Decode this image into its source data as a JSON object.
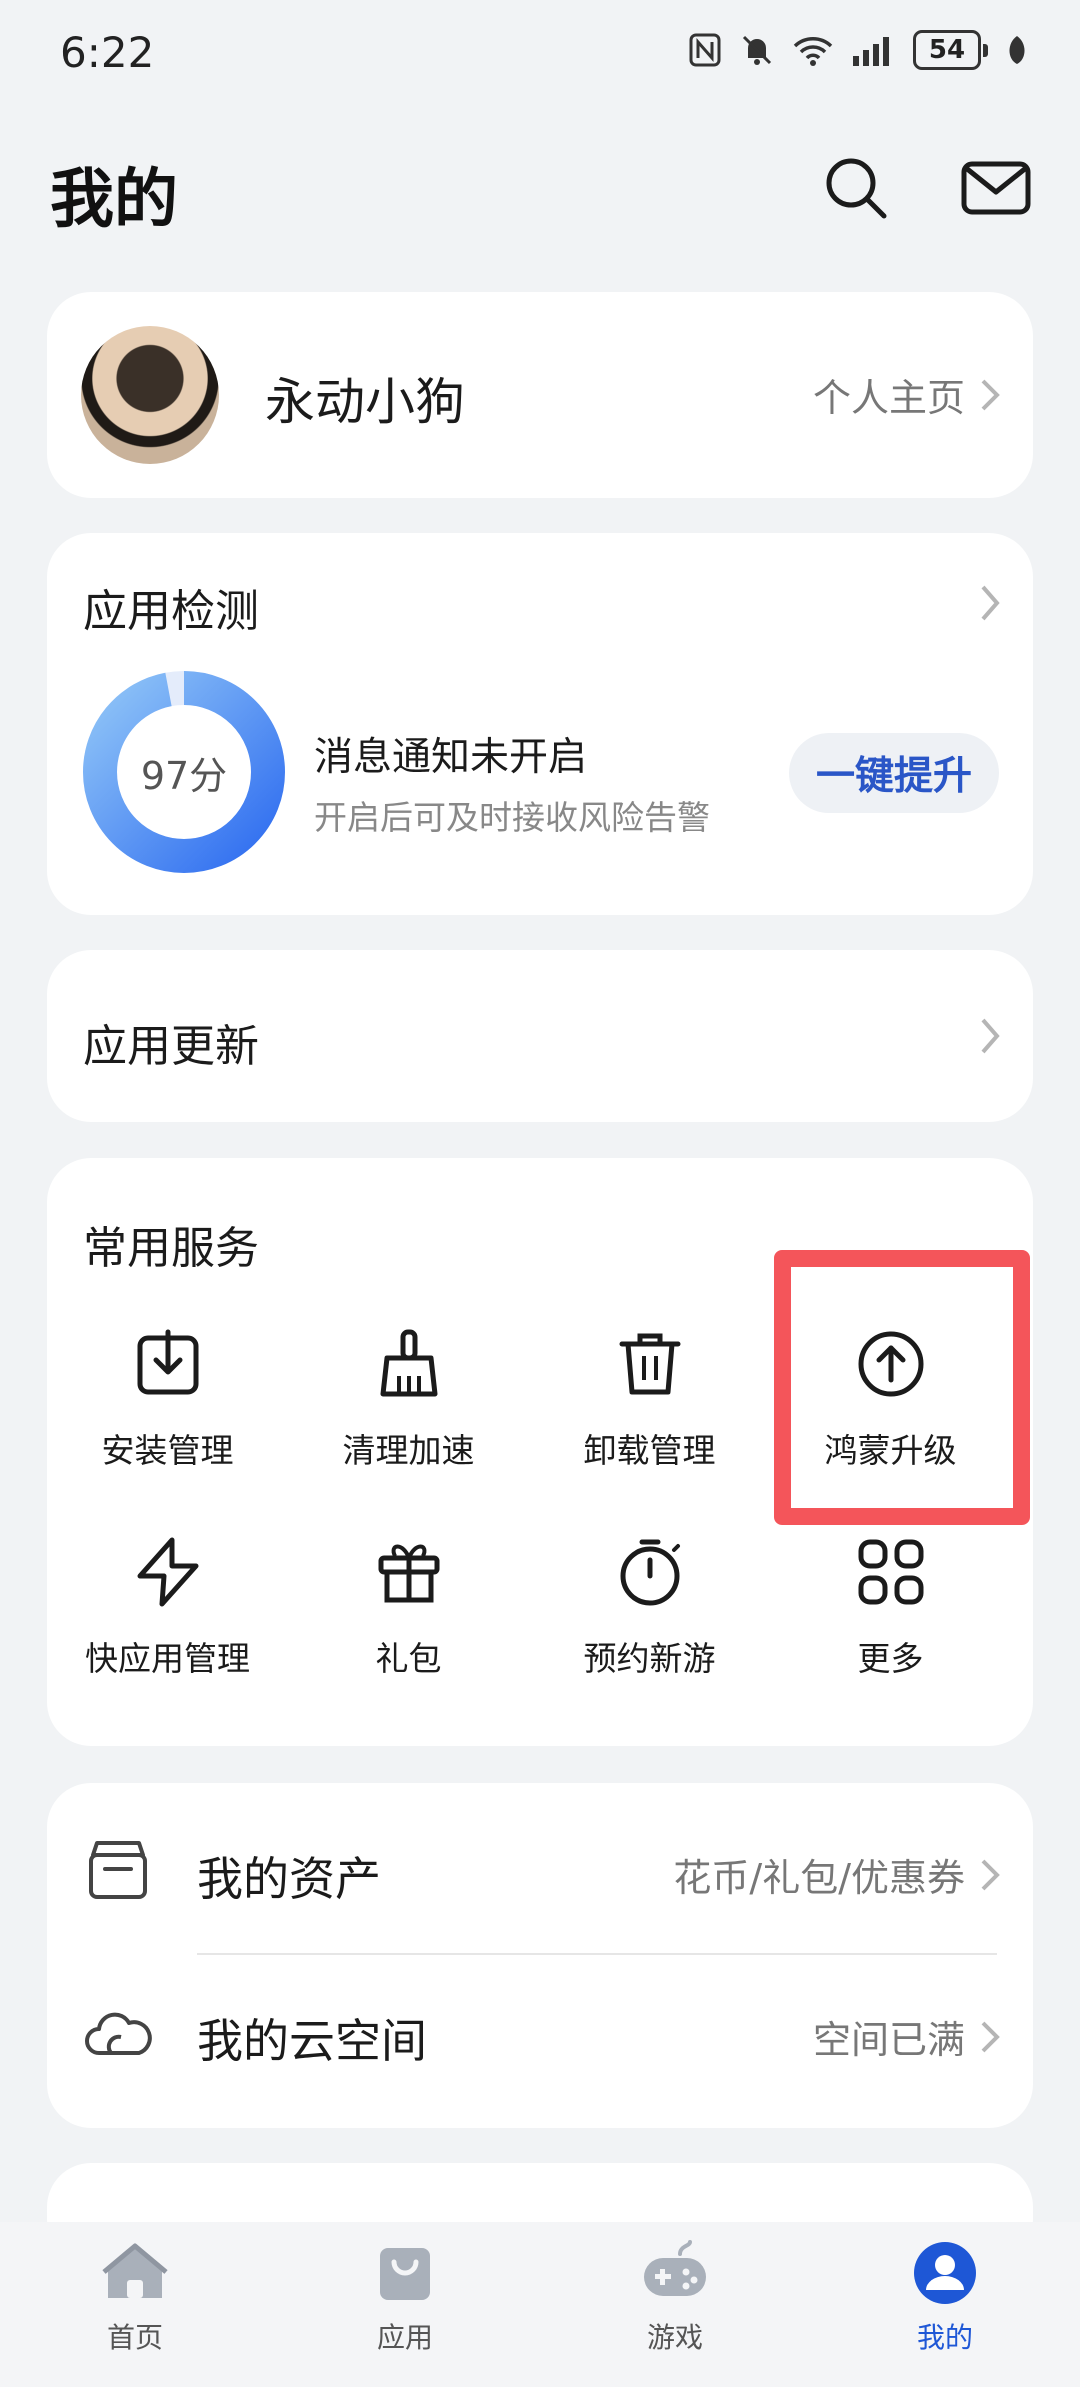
{
  "status_bar": {
    "time": "6:22",
    "battery": "54"
  },
  "header": {
    "title": "我的"
  },
  "profile": {
    "name": "永动小狗",
    "link_label": "个人主页"
  },
  "app_check": {
    "title": "应用检测",
    "score_label": "97分",
    "score_fraction": 0.97,
    "alert_title": "消息通知未开启",
    "alert_subtitle": "开启后可及时接收风险告警",
    "action_label": "一键提升"
  },
  "app_update": {
    "title": "应用更新"
  },
  "services": {
    "title": "常用服务",
    "items": [
      {
        "label": "安装管理",
        "icon": "install-icon"
      },
      {
        "label": "清理加速",
        "icon": "broom-icon"
      },
      {
        "label": "卸载管理",
        "icon": "trash-icon"
      },
      {
        "label": "鸿蒙升级",
        "icon": "upgrade-arrow-icon"
      },
      {
        "label": "快应用管理",
        "icon": "quick-app-icon"
      },
      {
        "label": "礼包",
        "icon": "gift-icon"
      },
      {
        "label": "预约新游",
        "icon": "stopwatch-icon"
      },
      {
        "label": "更多",
        "icon": "more-grid-icon"
      }
    ]
  },
  "assets": {
    "items": [
      {
        "title": "我的资产",
        "detail": "花币/礼包/优惠券",
        "icon": "wallet-icon"
      },
      {
        "title": "我的云空间",
        "detail": "空间已满",
        "icon": "cloud-icon"
      }
    ]
  },
  "bottom_nav": {
    "items": [
      {
        "label": "首页",
        "icon": "home-icon"
      },
      {
        "label": "应用",
        "icon": "app-bag-icon"
      },
      {
        "label": "游戏",
        "icon": "gamepad-icon"
      },
      {
        "label": "我的",
        "icon": "profile-icon",
        "active": true
      }
    ]
  },
  "colors": {
    "accent": "#1e57d6",
    "highlight": "#f4555a",
    "ring_start": "#2f6df0",
    "ring_end": "#8fc4f7"
  }
}
